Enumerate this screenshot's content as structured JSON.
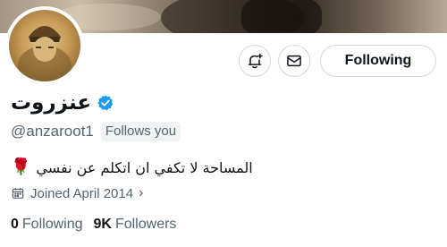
{
  "profile": {
    "display_name": "عنزروت",
    "handle": "@anzaroot1",
    "follows_you": "Follows you",
    "bio": "المساحة لا تكفي ان اتكلم عن نفسي",
    "bio_emoji": "🌹",
    "joined": "Joined April 2014",
    "following_count": "0",
    "following_label": "Following",
    "followers_count": "9K",
    "followers_label": "Followers"
  },
  "actions": {
    "follow_button_label": "Following",
    "notify_icon": "bell-plus-icon",
    "message_icon": "envelope-icon"
  },
  "colors": {
    "verified": "#1d9bf0",
    "text_primary": "#0f1419",
    "text_secondary": "#536471",
    "border": "#cfd9de",
    "badge_bg": "#eff3f4"
  }
}
